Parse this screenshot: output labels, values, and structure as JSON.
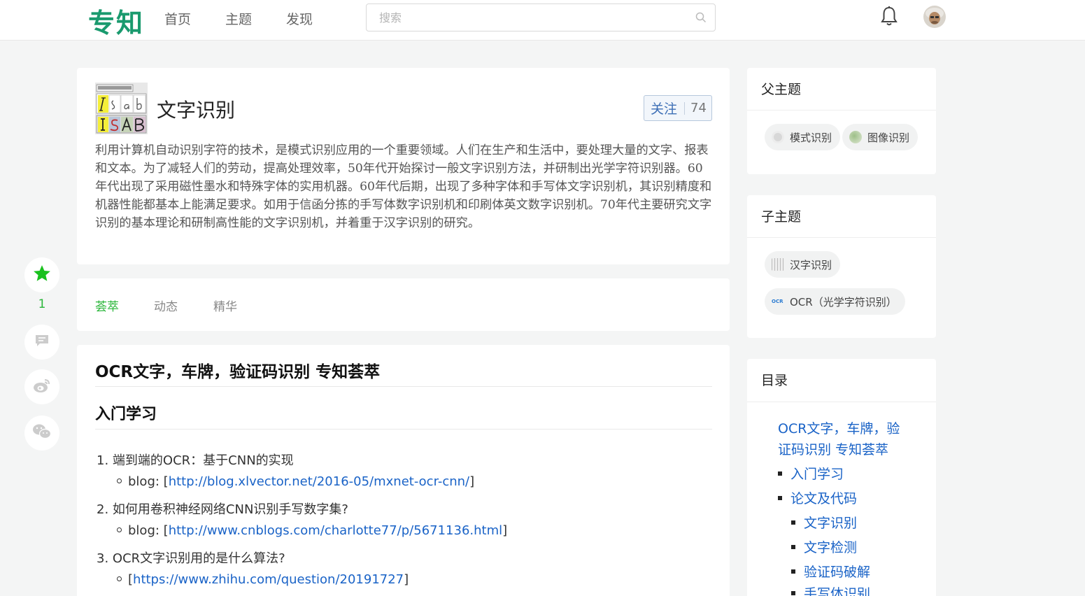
{
  "header": {
    "logo": "专知",
    "nav": [
      "首页",
      "主题",
      "发现"
    ],
    "search_placeholder": "搜索"
  },
  "topic": {
    "title": "文字识别",
    "follow_label": "关注",
    "follow_count": "74",
    "description": "利用计算机自动识别字符的技术，是模式识别应用的一个重要领域。人们在生产和生活中，要处理大量的文字、报表和文本。为了减轻人们的劳动，提高处理效率，50年代开始探讨一般文字识别方法，并研制出光学字符识别器。60年代出现了采用磁性墨水和特殊字体的实用机器。60年代后期，出现了多种字体和手写体文字识别机，其识别精度和机器性能都基本上能满足要求。如用于信函分拣的手写体数字识别机和印刷体英文数字识别机。70年代主要研究文字识别的基本理论和研制高性能的文字识别机，并着重于汉字识别的研究。"
  },
  "tabs": [
    "荟萃",
    "动态",
    "精华"
  ],
  "float_bar": {
    "star_count": "1"
  },
  "article": {
    "title": "OCR文字，车牌，验证码识别 专知荟萃",
    "section": "入门学习",
    "items": [
      {
        "num": "1.",
        "text": "端到端的OCR：基于CNN的实现",
        "sub_prefix": "blog: [",
        "sub_link": "http://blog.xlvector.net/2016-05/mxnet-ocr-cnn/",
        "sub_suffix": "]"
      },
      {
        "num": "2.",
        "text": "如何用卷积神经网络CNN识别手写数字集?",
        "sub_prefix": "blog: [",
        "sub_link": "http://www.cnblogs.com/charlotte77/p/5671136.html",
        "sub_suffix": "]"
      },
      {
        "num": "3.",
        "text": "OCR文字识别用的是什么算法?",
        "sub_prefix": "[",
        "sub_link": "https://www.zhihu.com/question/20191727",
        "sub_suffix": "]"
      }
    ]
  },
  "sidebar": {
    "parent_title": "父主题",
    "parents": [
      "模式识别",
      "图像识别"
    ],
    "child_title": "子主题",
    "children": [
      "汉字识别",
      "OCR（光学字符识别）"
    ],
    "toc_title": "目录",
    "toc_main_line1": "OCR文字，车牌，验",
    "toc_main_line2": "证码识别 专知荟萃",
    "toc_items": [
      "入门学习",
      "论文及代码"
    ],
    "toc_sub_items": [
      "文字识别",
      "文字检测",
      "验证码破解",
      "手写体识别"
    ]
  }
}
